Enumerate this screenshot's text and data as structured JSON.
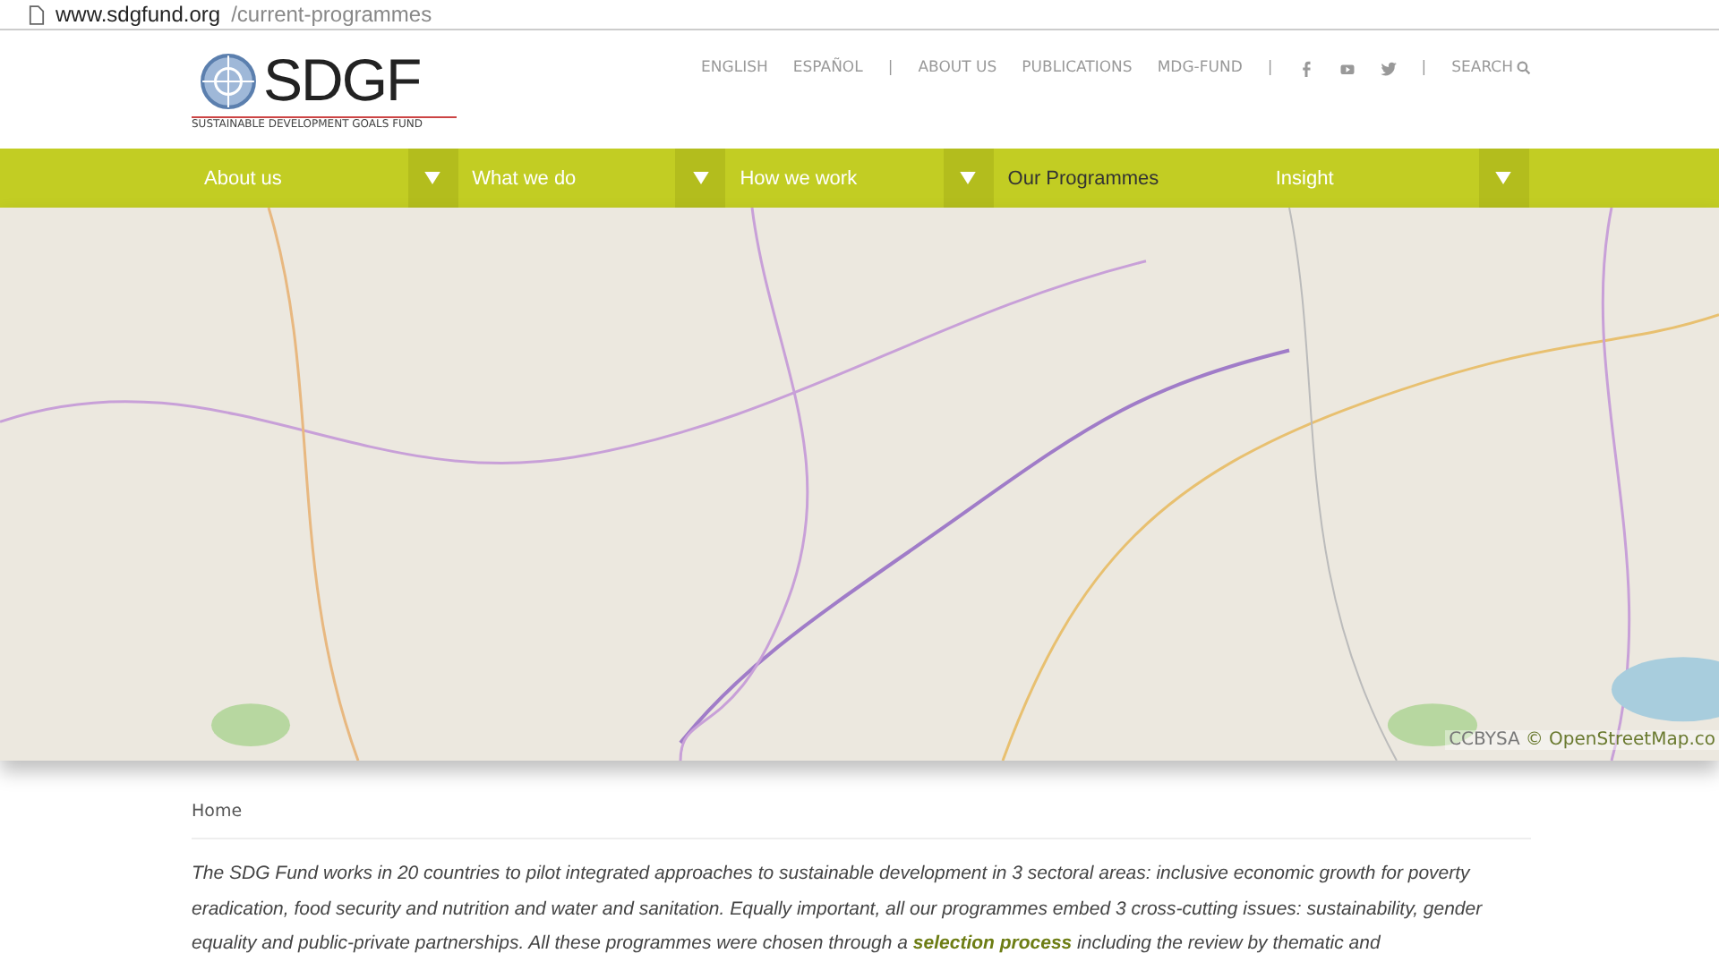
{
  "address_bar": {
    "domain": "www.sdgfund.org",
    "path": "/current-programmes"
  },
  "logo": {
    "letters": "SDGF",
    "tagline": "SUSTAINABLE DEVELOPMENT GOALS FUND"
  },
  "top_links": {
    "languages": [
      "ENGLISH",
      "ESPAÑOL"
    ],
    "separators": [
      "|",
      "|",
      "|"
    ],
    "pages": [
      "ABOUT US",
      "PUBLICATIONS",
      "MDG-FUND"
    ],
    "search": "SEARCH"
  },
  "nav": [
    {
      "label": "About us",
      "selected": false,
      "dropdown": true
    },
    {
      "label": "What we do",
      "selected": false,
      "dropdown": true
    },
    {
      "label": "How we work",
      "selected": false,
      "dropdown": true
    },
    {
      "label": "Our Programmes",
      "selected": true,
      "dropdown": false
    },
    {
      "label": "Insight",
      "selected": false,
      "dropdown": true
    }
  ],
  "map": {
    "attribution_license": "CCBYSA",
    "attribution_source": "© OpenStreetMap.co"
  },
  "breadcrumb": "Home",
  "intro": {
    "before": "The SDG Fund works in 20 countries to pilot integrated approaches to sustainable development in 3 sectoral areas: inclusive economic growth for poverty eradication, food security and nutrition and water and sanitation. Equally important, all our programmes embed 3 cross-cutting issues: sustainability, gender equality and public-private partnerships. All these programmes were chosen through a",
    "link": "selection process",
    "after": "including the review by thematic and"
  }
}
